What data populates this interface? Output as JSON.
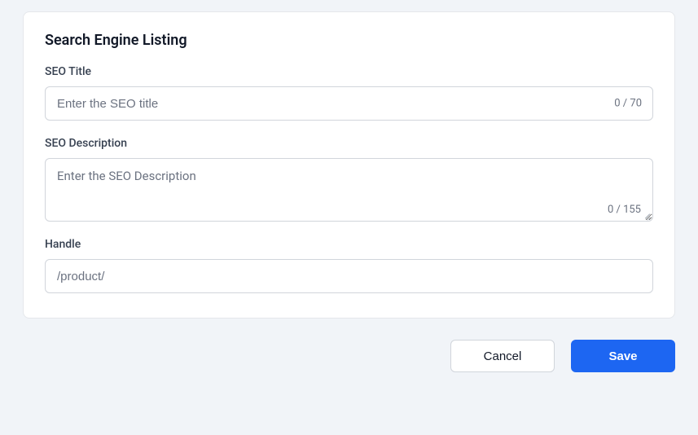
{
  "card": {
    "title": "Search Engine Listing"
  },
  "seoTitle": {
    "label": "SEO Title",
    "placeholder": "Enter the SEO title",
    "value": "",
    "counter": "0 / 70"
  },
  "seoDescription": {
    "label": "SEO Description",
    "placeholder": "Enter the SEO Description",
    "value": "",
    "counter": "0 / 155"
  },
  "handle": {
    "label": "Handle",
    "placeholder": "/product/",
    "value": ""
  },
  "actions": {
    "cancel": "Cancel",
    "save": "Save"
  }
}
